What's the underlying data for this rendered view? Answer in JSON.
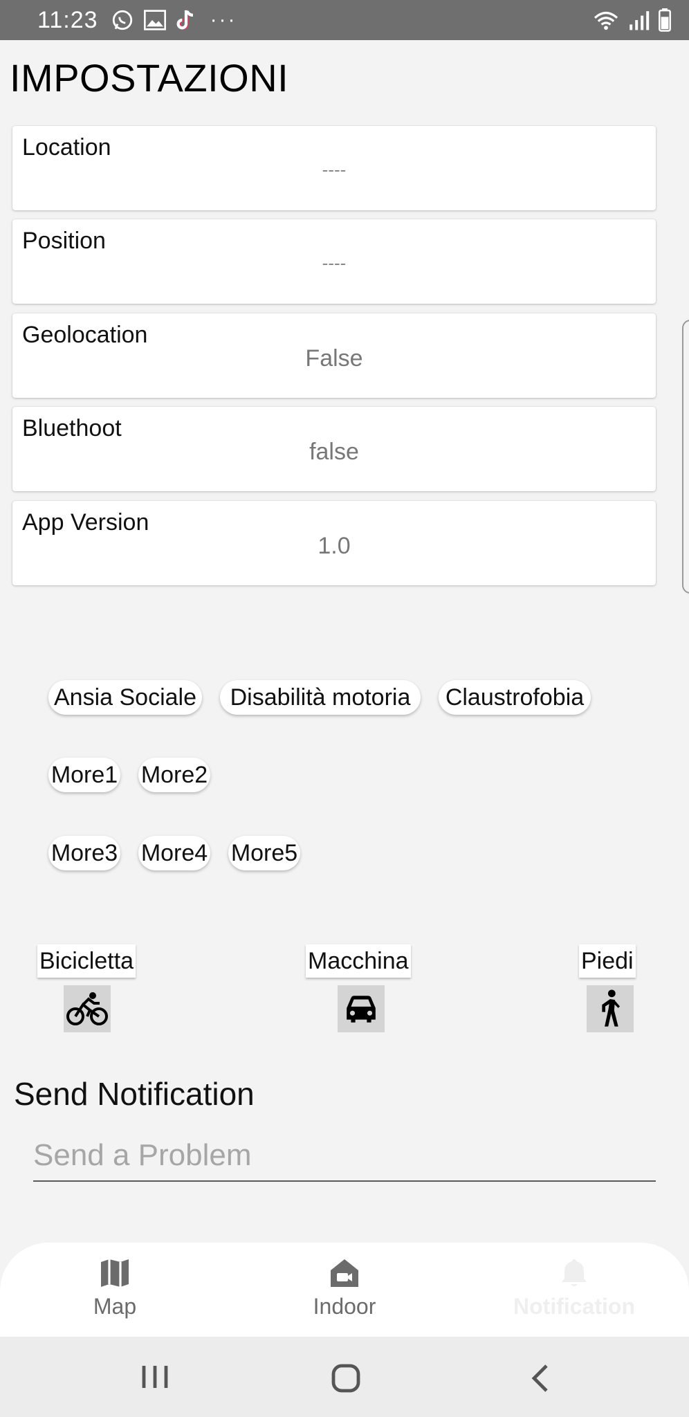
{
  "status_bar": {
    "time": "11:23",
    "icons": [
      "whatsapp-icon",
      "gallery-icon",
      "tiktok-icon",
      "more-dots-icon"
    ],
    "more": "···",
    "right_icons": [
      "wifi-icon",
      "signal-icon",
      "battery-icon"
    ]
  },
  "page": {
    "title": "IMPOSTAZIONI"
  },
  "info_cards": [
    {
      "label": "Location",
      "value": "----"
    },
    {
      "label": "Position",
      "value": "----"
    },
    {
      "label": "Geolocation",
      "value": "False"
    },
    {
      "label": "Bluethoot",
      "value": "false"
    },
    {
      "label": "App Version",
      "value": "1.0"
    }
  ],
  "chips": [
    "Ansia Sociale",
    "Disabilità motoria",
    "Claustrofobia",
    "More1",
    "More2",
    "More3",
    "More4",
    "More5"
  ],
  "transport": [
    {
      "label": "Bicicletta",
      "icon": "bicycle-icon"
    },
    {
      "label": "Macchina",
      "icon": "car-icon"
    },
    {
      "label": "Piedi",
      "icon": "walking-icon"
    }
  ],
  "notification": {
    "title": "Send Notification",
    "placeholder": "Send a Problem"
  },
  "bottom_nav": [
    {
      "label": "Map",
      "icon": "map-icon",
      "active": false
    },
    {
      "label": "Indoor",
      "icon": "indoor-icon",
      "active": false
    },
    {
      "label": "Notification",
      "icon": "bell-icon",
      "active": true
    }
  ],
  "colors": {
    "background": "#f3f3f3",
    "status_bar": "#6f6f6f",
    "card": "#ffffff",
    "mode_button": "#d4d4d4",
    "nav_inactive": "#6b6b6b",
    "nav_active": "#efefef"
  }
}
